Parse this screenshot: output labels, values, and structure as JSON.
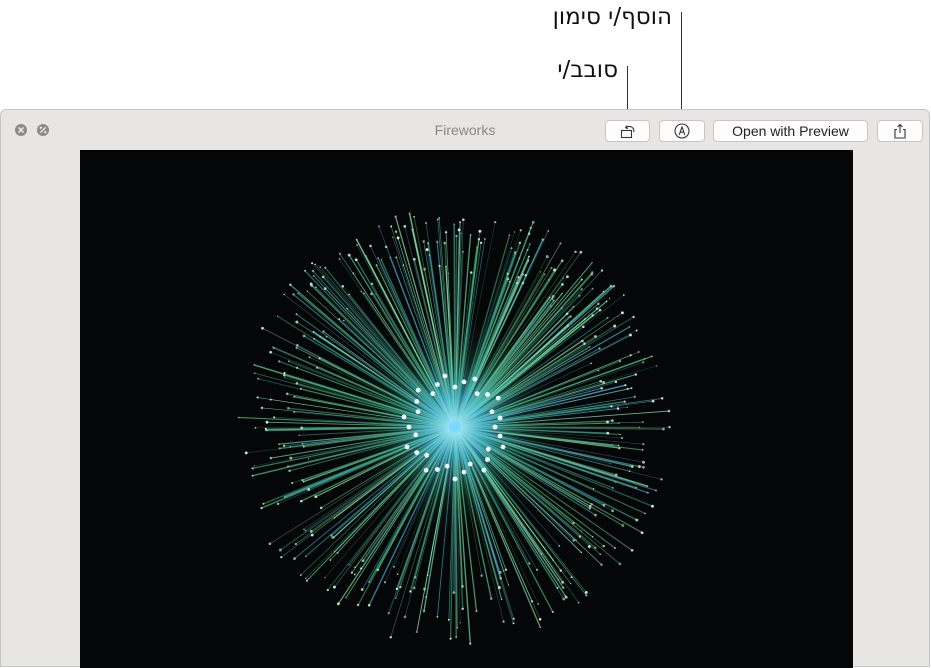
{
  "callouts": {
    "markup_label": "הוסף/י סימון",
    "rotate_label": "סובב/י"
  },
  "window": {
    "title": "Fireworks"
  },
  "toolbar": {
    "rotate_icon": "rotate-icon",
    "markup_icon": "markup-icon",
    "open_label": "Open with Preview",
    "share_icon": "share-icon"
  },
  "image": {
    "subject": "green fireworks burst",
    "colors": {
      "background": "#050607",
      "rays": "#57c58c",
      "core": "#7fd8ff"
    }
  }
}
